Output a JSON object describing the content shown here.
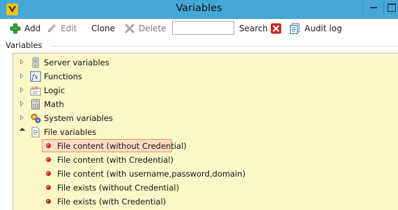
{
  "window": {
    "title": "Variables"
  },
  "toolbar": {
    "add_label": "Add",
    "edit_label": "Edit",
    "clone_label": "Clone",
    "delete_label": "Delete",
    "search_value": "",
    "search_label": "Search",
    "audit_label": "Audit log"
  },
  "group": {
    "label": "Variables"
  },
  "tree": {
    "nodes": [
      {
        "label": "Server variables",
        "icon": "server-icon"
      },
      {
        "label": "Functions",
        "icon": "function-icon"
      },
      {
        "label": "Logic",
        "icon": "logic-icon"
      },
      {
        "label": "Math",
        "icon": "calculator-icon"
      },
      {
        "label": "System variables",
        "icon": "gears-icon"
      },
      {
        "label": "File variables",
        "icon": "file-icon",
        "expanded": true
      }
    ],
    "file_children": [
      {
        "label": "File content (without Credential)",
        "selected": true
      },
      {
        "label": "File content (with Credential)"
      },
      {
        "label": "File content (with username,password,domain)"
      },
      {
        "label": "File exists (without Credential)"
      },
      {
        "label": "File exists (with Credential)"
      }
    ]
  },
  "colors": {
    "titlebar": "#44a7d8",
    "tree_background": "#fdf7c8",
    "selection_fill": "#fbdcc3",
    "selection_border": "#e8965a",
    "leaf_dot": "#e02b2b"
  }
}
